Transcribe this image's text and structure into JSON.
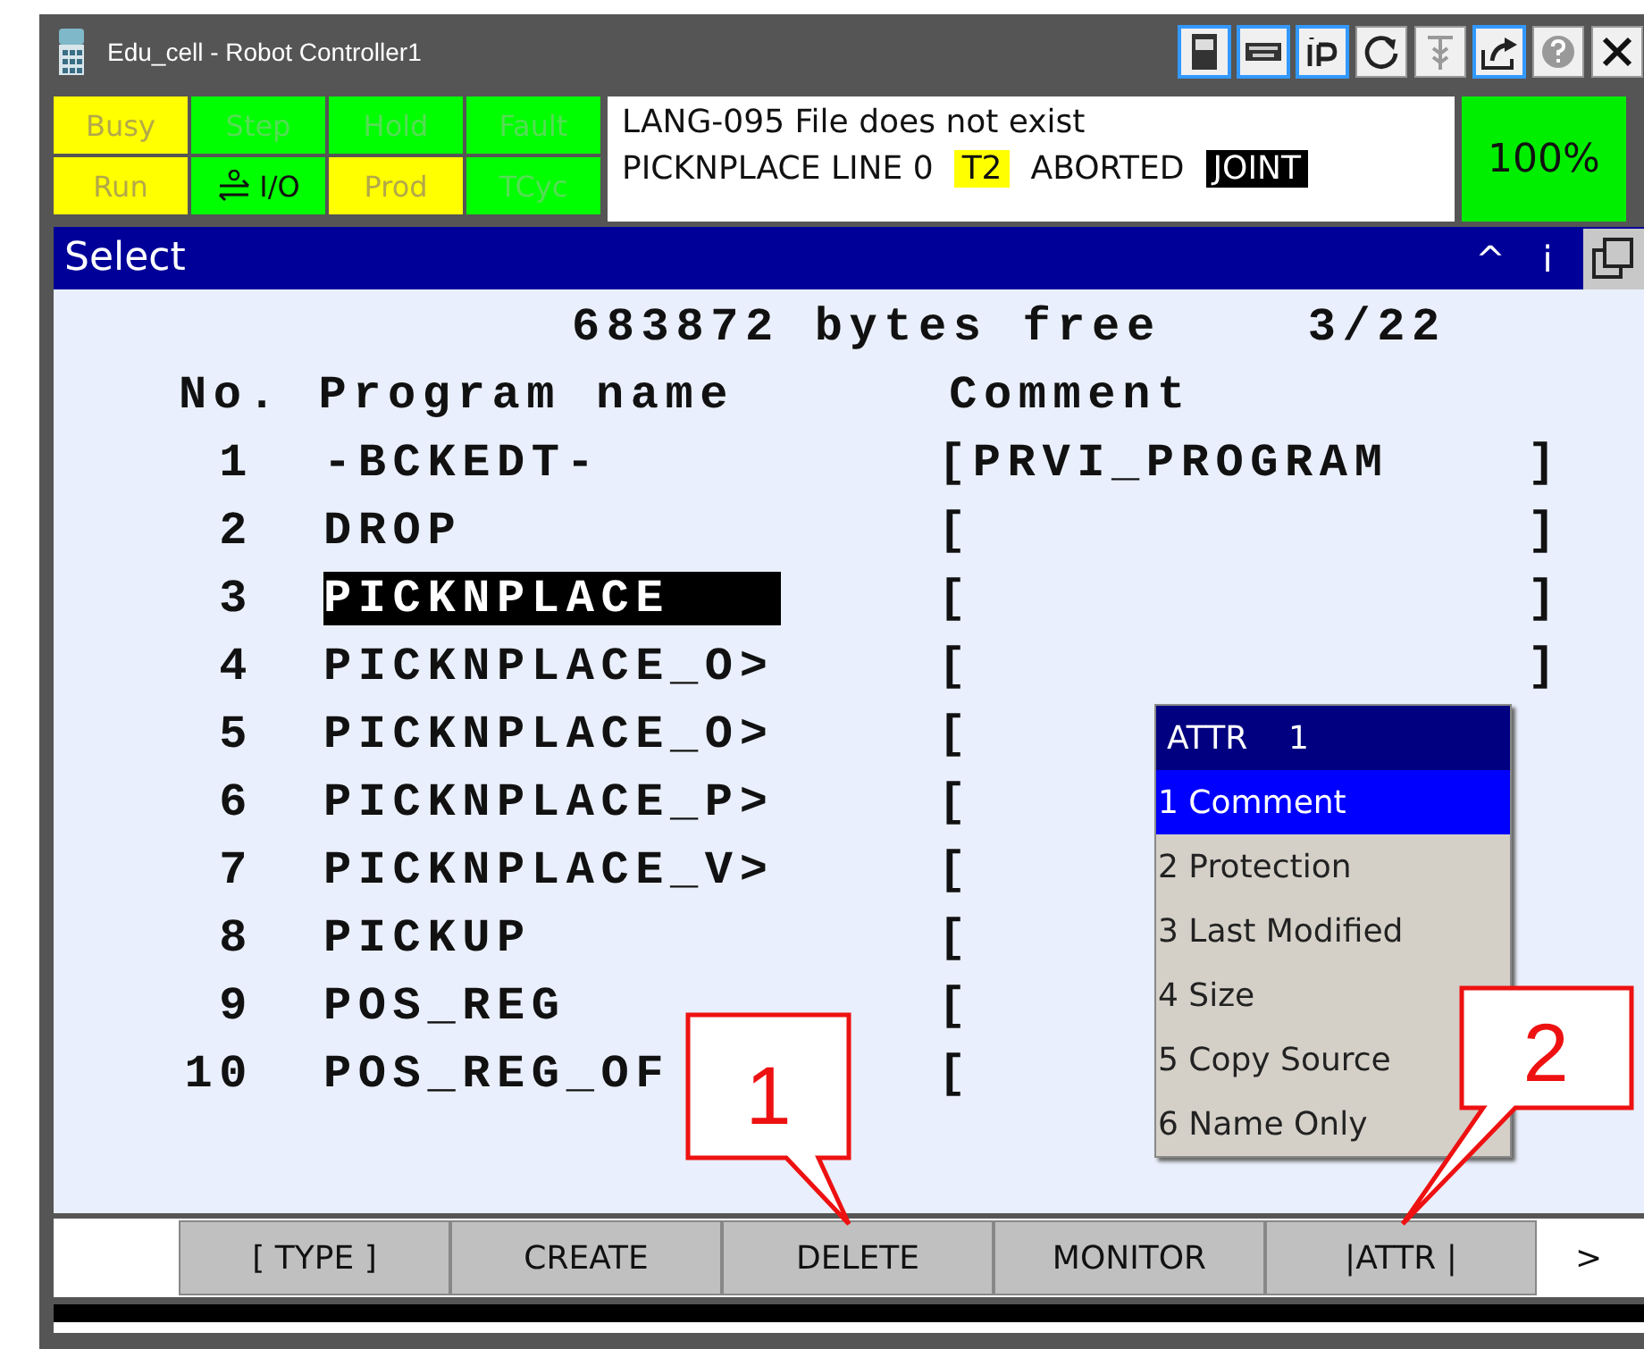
{
  "window": {
    "title": "Edu_cell - Robot Controller1"
  },
  "indicators": [
    {
      "label": "Busy",
      "color": "#ffff00",
      "on": false
    },
    {
      "label": "Step",
      "color": "#00ff00",
      "on": false
    },
    {
      "label": "Hold",
      "color": "#00ff00",
      "on": false
    },
    {
      "label": "Fault",
      "color": "#00ff00",
      "on": false
    },
    {
      "label": "Run",
      "color": "#ffff00",
      "on": false
    },
    {
      "label": "I/O",
      "color": "#00ff00",
      "on": true
    },
    {
      "label": "Prod",
      "color": "#ffff00",
      "on": false
    },
    {
      "label": "TCyc",
      "color": "#00ff00",
      "on": false
    }
  ],
  "message": {
    "line_1": "LANG-095 File does not exist",
    "line_2": [
      {
        "text": "PICKNPLACE LINE 0",
        "kind": "plain"
      },
      {
        "text": "T2",
        "kind": "highlight"
      },
      {
        "text": "ABORTED",
        "kind": "plain"
      },
      {
        "text": "JOINT",
        "kind": "inverse"
      }
    ]
  },
  "override": "100%",
  "screen": {
    "title": "Select",
    "up": "^",
    "info": "i"
  },
  "memory": "683872 bytes free",
  "position": "3/22",
  "columns": [
    "No.",
    "Program name",
    "Comment"
  ],
  "programs": [
    {
      "no": "1",
      "name": "-BCKEDT-",
      "comment": "[PRVI_PROGRAM    ]",
      "selected": false
    },
    {
      "no": "2",
      "name": "DROP",
      "comment": "[                ]",
      "selected": false
    },
    {
      "no": "3",
      "name": "PICKNPLACE",
      "comment": "[                ]",
      "selected": true
    },
    {
      "no": "4",
      "name": "PICKNPLACE_O>",
      "comment": "[                ]",
      "selected": false
    },
    {
      "no": "5",
      "name": "PICKNPLACE_O>",
      "comment": "[",
      "selected": false
    },
    {
      "no": "6",
      "name": "PICKNPLACE_P>",
      "comment": "[",
      "selected": false
    },
    {
      "no": "7",
      "name": "PICKNPLACE_V>",
      "comment": "[",
      "selected": false
    },
    {
      "no": "8",
      "name": "PICKUP",
      "comment": "[",
      "selected": false
    },
    {
      "no": "9",
      "name": "POS_REG",
      "comment": "[",
      "selected": false
    },
    {
      "no": "10",
      "name": "POS_REG_OF",
      "comment": "[",
      "selected": false
    }
  ],
  "popup": {
    "title": "ATTR    1",
    "items": [
      {
        "label": "1 Comment",
        "selected": true
      },
      {
        "label": "2 Protection",
        "selected": false
      },
      {
        "label": "3 Last Modified",
        "selected": false
      },
      {
        "label": "4 Size",
        "selected": false
      },
      {
        "label": "5 Copy Source",
        "selected": false
      },
      {
        "label": "6 Name Only",
        "selected": false
      }
    ]
  },
  "function_keys": [
    "[ TYPE ]",
    "CREATE",
    "DELETE",
    "MONITOR",
    "|ATTR |"
  ],
  "next_key": ">",
  "callouts": [
    {
      "label": "1"
    },
    {
      "label": "2"
    }
  ]
}
